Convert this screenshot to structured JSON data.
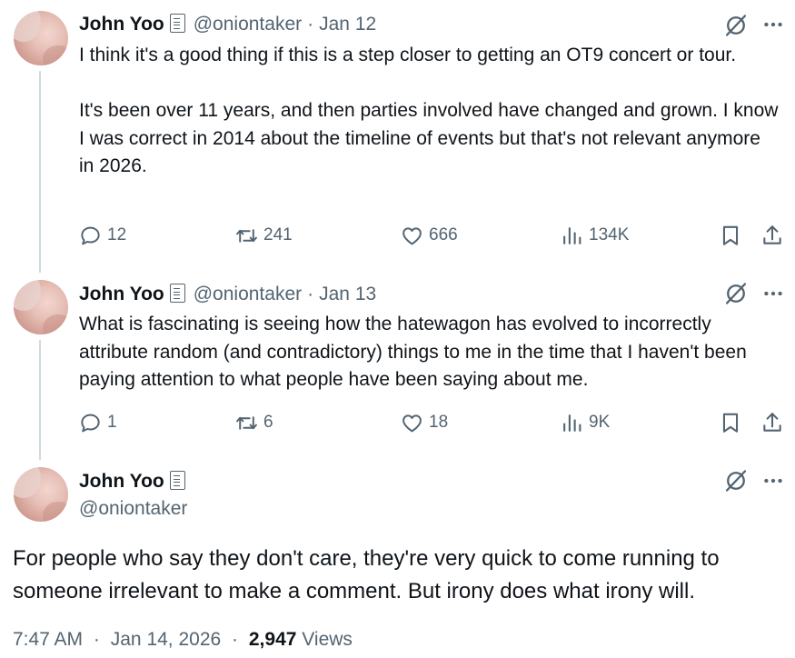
{
  "tweets": [
    {
      "name": "John Yoo",
      "handle": "@oniontaker",
      "separator": "·",
      "date": "Jan 12",
      "text": "I think it's a good thing if this is a step closer to getting an OT9 concert or tour.\n\nIt's been over 11 years, and then parties involved have changed and grown. I know I was correct in 2014 about the timeline of events but that's not relevant anymore in 2026.",
      "replies": "12",
      "reposts": "241",
      "likes": "666",
      "views": "134K"
    },
    {
      "name": "John Yoo",
      "handle": "@oniontaker",
      "separator": "·",
      "date": "Jan 13",
      "text": "What is fascinating is seeing how the hatewagon has evolved to incorrectly attribute random (and contradictory) things to me in the time that I haven't been paying attention to what people have been saying about me.",
      "replies": "1",
      "reposts": "6",
      "likes": "18",
      "views": "9K"
    }
  ],
  "main_tweet": {
    "name": "John Yoo",
    "handle": "@oniontaker",
    "text": "For people who say they don't care, they're very quick to come running to someone irrelevant to make a comment. But irony does what irony will.",
    "time": "7:47 AM",
    "date": "Jan 14, 2026",
    "separator": "·",
    "views_count": "2,947",
    "views_label": "Views"
  },
  "icons": {
    "grok": "grok-icon",
    "more": "more-icon",
    "reply": "reply-icon",
    "repost": "repost-icon",
    "like": "heart-icon",
    "views": "views-icon",
    "bookmark": "bookmark-icon",
    "share": "share-icon"
  },
  "colors": {
    "text": "#0f1419",
    "secondary": "#536471",
    "thread_line": "#cfd9de"
  }
}
